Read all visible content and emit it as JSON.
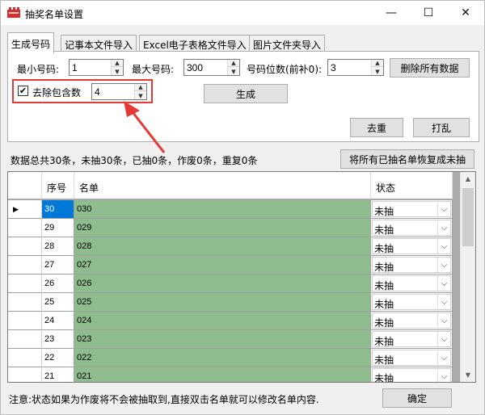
{
  "window": {
    "title": "抽奖名单设置",
    "minimize_glyph": "—",
    "maximize_glyph": "☐",
    "close_glyph": "✕",
    "icon": "red-tickets-icon"
  },
  "tabs": [
    {
      "label": "生成号码",
      "active": true
    },
    {
      "label": "记事本文件导入",
      "active": false
    },
    {
      "label": "Excel电子表格文件导入",
      "active": false
    },
    {
      "label": "图片文件夹导入",
      "active": false
    }
  ],
  "generate": {
    "min_label": "最小号码:",
    "min_value": "1",
    "max_label": "最大号码:",
    "max_value": "300",
    "digits_label": "号码位数(前补0):",
    "digits_value": "3",
    "delete_all_button": "删除所有数据",
    "exclude_label": "去除包含数",
    "exclude_checked": true,
    "exclude_value": "4",
    "generate_button": "生成",
    "dedupe_button": "去重",
    "shuffle_button": "打乱"
  },
  "stats_text": "数据总共30条，未抽30条，已抽0条，作废0条，重复0条",
  "restore_button": "将所有已抽名单恢复成未抽",
  "table": {
    "columns": [
      "序号",
      "名单",
      "状态"
    ],
    "selected_row_indicator": "▶",
    "rows": [
      {
        "no": "30",
        "name": "030",
        "status": "未抽"
      },
      {
        "no": "29",
        "name": "029",
        "status": "未抽"
      },
      {
        "no": "28",
        "name": "028",
        "status": "未抽"
      },
      {
        "no": "27",
        "name": "027",
        "status": "未抽"
      },
      {
        "no": "26",
        "name": "026",
        "status": "未抽"
      },
      {
        "no": "25",
        "name": "025",
        "status": "未抽"
      },
      {
        "no": "24",
        "name": "024",
        "status": "未抽"
      },
      {
        "no": "23",
        "name": "023",
        "status": "未抽"
      },
      {
        "no": "22",
        "name": "022",
        "status": "未抽"
      },
      {
        "no": "21",
        "name": "021",
        "status": "未抽"
      }
    ]
  },
  "footer": {
    "note": "注意:状态如果为作废将不会被抽取到,直接双击名单就可以修改名单内容.",
    "ok_button": "确定"
  },
  "colors": {
    "name_cell_bg": "#8fbc8f",
    "selection": "#0078d7",
    "annotation_red": "#e53935"
  }
}
